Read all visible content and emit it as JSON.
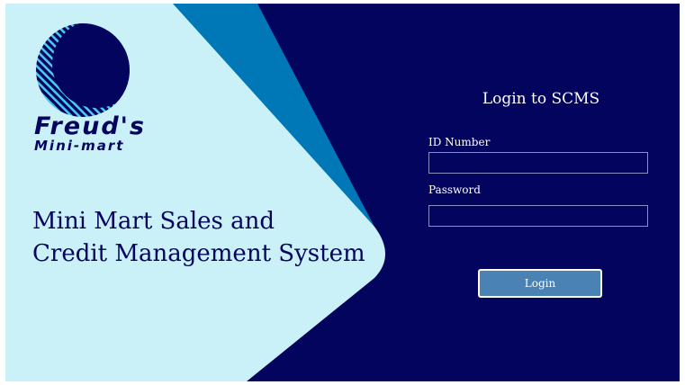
{
  "colors": {
    "navy": "#03045e",
    "light_panel": "#caf0f8",
    "accent_blue": "#0077b6",
    "button_blue": "#4a82b4"
  },
  "brand": {
    "logo_icon": "striped-circle-logo-icon",
    "name_line1": "Freud's",
    "name_line2": "Mini-mart"
  },
  "system_title": {
    "line1": "Mini Mart Sales and",
    "line2": "Credit Management System"
  },
  "login": {
    "heading": "Login to SCMS",
    "id_label": "ID Number",
    "id_value": "",
    "password_label": "Password",
    "password_value": "",
    "button_label": "Login"
  }
}
